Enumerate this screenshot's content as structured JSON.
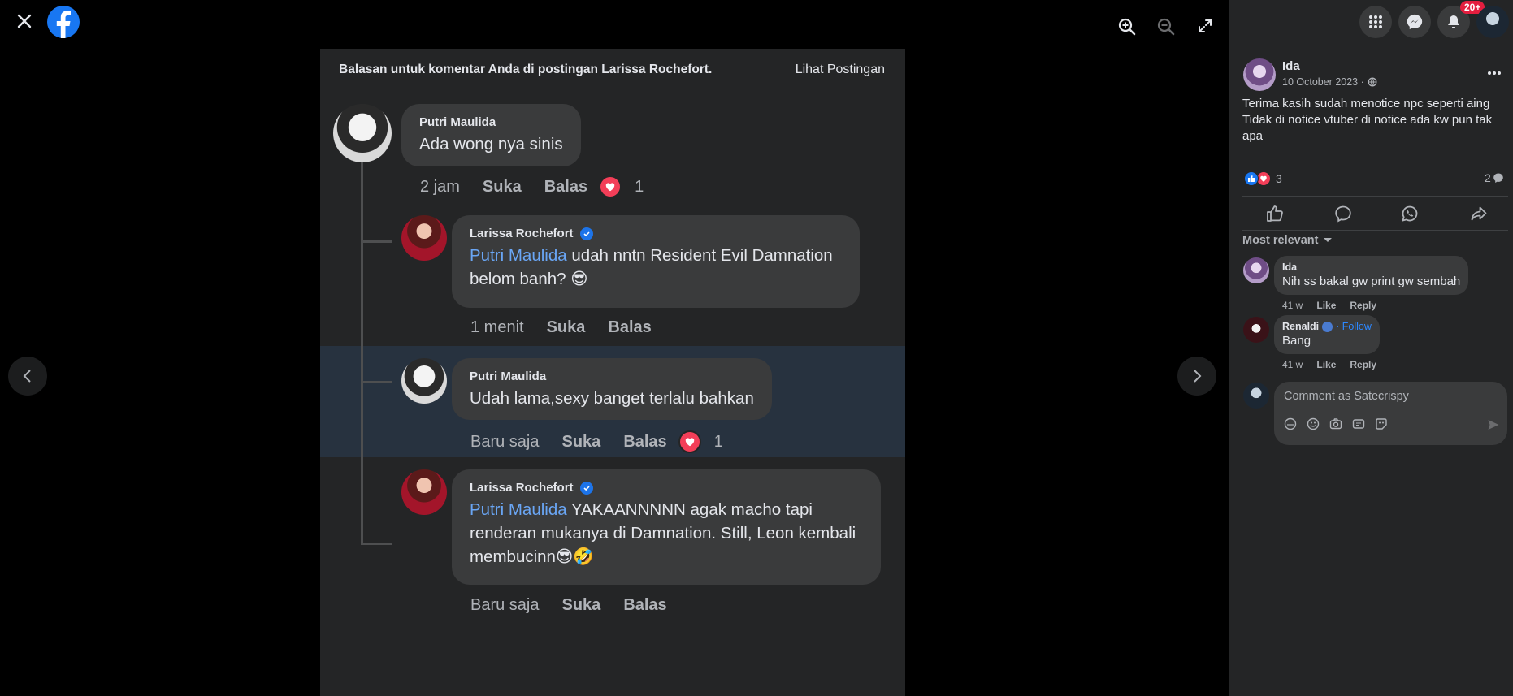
{
  "viewer": {
    "icons": [
      "close-icon",
      "facebook-logo",
      "zoom-in-icon",
      "zoom-out-icon",
      "fullscreen-icon",
      "previous-icon",
      "next-icon"
    ]
  },
  "screenshot": {
    "header_title": "Balasan untuk komentar Anda di postingan Larissa Rochefort.",
    "header_link": "Lihat Postingan",
    "comments": [
      {
        "name": "Putri Maulida",
        "text": "Ada wong nya sinis",
        "time": "2 jam",
        "like": "Suka",
        "reply": "Balas",
        "reactions": "1"
      },
      {
        "name": "Larissa Rochefort",
        "mention": "Putri Maulida",
        "text": " udah nntn Resident Evil Damnation belom banh? 😎",
        "time": "1 menit",
        "like": "Suka",
        "reply": "Balas"
      },
      {
        "name": "Putri Maulida",
        "text": "Udah lama,sexy banget terlalu bahkan",
        "time": "Baru saja",
        "like": "Suka",
        "reply": "Balas",
        "reactions": "1"
      },
      {
        "name": "Larissa Rochefort",
        "mention": "Putri Maulida",
        "text": " YAKAANNNNN agak macho tapi renderan mukanya di Damnation. Still, Leon kembali membucinn😎🤣",
        "time": "Baru saja",
        "like": "Suka",
        "reply": "Balas"
      }
    ]
  },
  "panel": {
    "notification_badge": "20+",
    "post": {
      "author": "Ida",
      "date": "10 October 2023 ·",
      "text_line1": "Terima kasih sudah menotice npc seperti aing",
      "text_line2": "Tidak di notice vtuber di notice ada kw pun tak apa",
      "reaction_count": "3",
      "comment_count": "2"
    },
    "sort_label": "Most relevant",
    "comments": [
      {
        "name": "Ida",
        "text": "Nih ss bakal gw print gw sembah",
        "time": "41 w",
        "like": "Like",
        "reply": "Reply"
      },
      {
        "name": "Renaldi",
        "follow": "· Follow",
        "text": "Bang",
        "time": "41 w",
        "like": "Like",
        "reply": "Reply"
      }
    ],
    "composer_placeholder": "Comment as Satecrispy"
  }
}
